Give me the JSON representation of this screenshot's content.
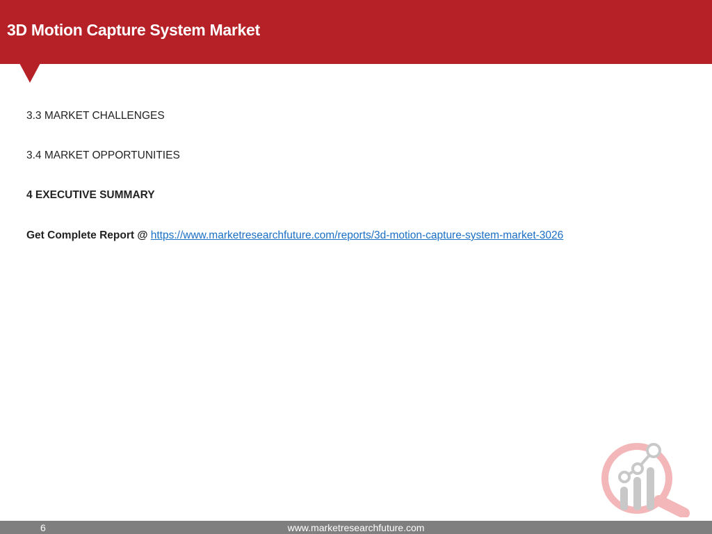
{
  "header": {
    "title": "3D Motion Capture System Market"
  },
  "content": {
    "lines": [
      "3.3 MARKET CHALLENGES",
      "3.4 MARKET OPPORTUNITIES",
      "4 EXECUTIVE SUMMARY"
    ],
    "report_prefix": "Get Complete Report @",
    "report_link": "https://www.marketresearchfuture.com/reports/3d-motion-capture-system-market-3026"
  },
  "footer": {
    "page_number": "6",
    "website": "www.marketresearchfuture.com"
  },
  "colors": {
    "header_red": "#b52127",
    "link_blue": "#1a6fc4",
    "footer_gray": "#7f7f7f",
    "logo_gray": "#c8c8c8",
    "logo_pink": "#f3b7b9"
  },
  "icons": {
    "watermark": "analytics-magnifier-logo-icon"
  }
}
